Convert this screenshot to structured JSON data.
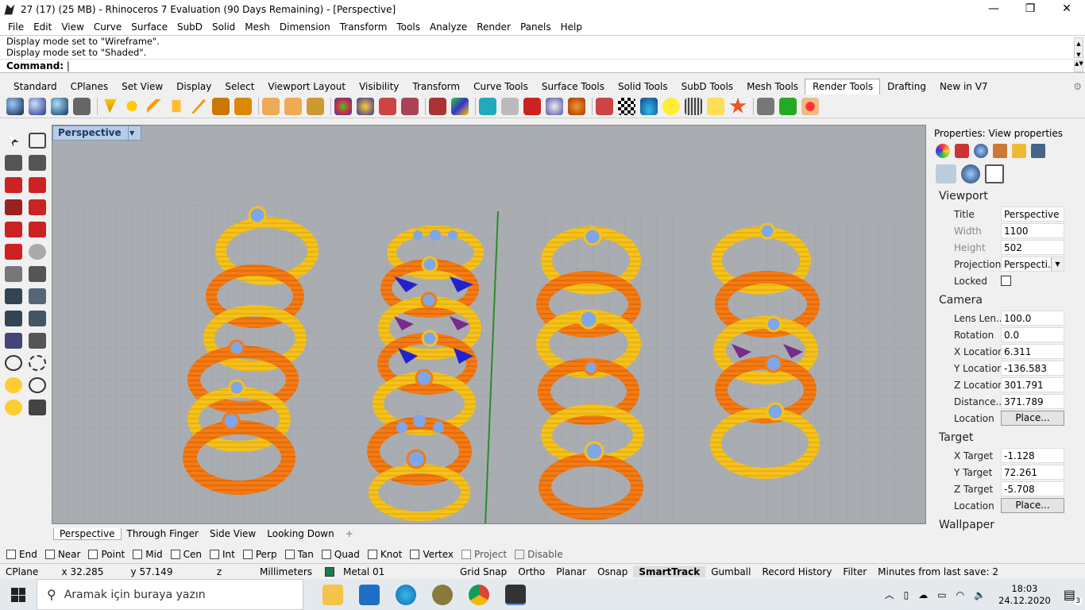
{
  "window": {
    "title": "27 (17) (25 MB) - Rhinoceros 7 Evaluation (90 Days Remaining) - [Perspective]",
    "minimize": "—",
    "restore": "❐",
    "close": "✕"
  },
  "menu": [
    "File",
    "Edit",
    "View",
    "Curve",
    "Surface",
    "SubD",
    "Solid",
    "Mesh",
    "Dimension",
    "Transform",
    "Tools",
    "Analyze",
    "Render",
    "Panels",
    "Help"
  ],
  "command_history": [
    "Display mode set to \"Wireframe\".",
    "Display mode set to \"Shaded\"."
  ],
  "command_prompt": "Command:",
  "toolbar_tabs": [
    "Standard",
    "CPlanes",
    "Set View",
    "Display",
    "Select",
    "Viewport Layout",
    "Visibility",
    "Transform",
    "Curve Tools",
    "Surface Tools",
    "Solid Tools",
    "SubD Tools",
    "Mesh Tools",
    "Render Tools",
    "Drafting",
    "New in V7"
  ],
  "active_toolbar_tab": "Render Tools",
  "viewport": {
    "name": "Perspective",
    "tabs": [
      "Perspective",
      "Through Finger",
      "Side View",
      "Looking Down"
    ],
    "add_tab": "+"
  },
  "properties": {
    "header": "Properties: View properties",
    "viewport_section": "Viewport",
    "viewport_rows": [
      {
        "key": "Title",
        "value": "Perspective",
        "dim": false
      },
      {
        "key": "Width",
        "value": "1100",
        "dim": true
      },
      {
        "key": "Height",
        "value": "502",
        "dim": true
      },
      {
        "key": "Projection",
        "value": "Perspecti...",
        "dim": false
      },
      {
        "key": "Locked",
        "value": "",
        "dim": false
      }
    ],
    "camera_section": "Camera",
    "camera_rows": [
      {
        "key": "Lens Len...",
        "value": "100.0"
      },
      {
        "key": "Rotation",
        "value": "0.0"
      },
      {
        "key": "X Location",
        "value": "6.311"
      },
      {
        "key": "Y Location",
        "value": "-136.583"
      },
      {
        "key": "Z Location",
        "value": "301.791"
      },
      {
        "key": "Distance...",
        "value": "371.789"
      },
      {
        "key": "Location",
        "value": "Place..."
      }
    ],
    "target_section": "Target",
    "target_rows": [
      {
        "key": "X Target",
        "value": "-1.128"
      },
      {
        "key": "Y Target",
        "value": "72.261"
      },
      {
        "key": "Z Target",
        "value": "-5.708"
      },
      {
        "key": "Location",
        "value": "Place..."
      }
    ],
    "wallpaper_section": "Wallpaper"
  },
  "osnap": [
    "End",
    "Near",
    "Point",
    "Mid",
    "Cen",
    "Int",
    "Perp",
    "Tan",
    "Quad",
    "Knot",
    "Vertex",
    "Project",
    "Disable"
  ],
  "status": {
    "cplane": "CPlane",
    "x": "x 32.285",
    "y": "y 57.149",
    "z": "z",
    "units": "Millimeters",
    "layer": "Metal 01",
    "layer_color": "#1e7a4e",
    "toggles": [
      "Grid Snap",
      "Ortho",
      "Planar",
      "Osnap",
      "SmartTrack",
      "Gumball",
      "Record History",
      "Filter"
    ],
    "bold_toggle": "SmartTrack",
    "save_info": "Minutes from last save: 2"
  },
  "taskbar": {
    "search_placeholder": "Aramak için buraya yazın",
    "time": "18:03",
    "date": "24.12.2020",
    "notifications": "3"
  },
  "colors": {
    "viewport_bg": "#a9adb1",
    "ring_gold": "#f5c21b",
    "ring_orange": "#f47a12",
    "gem_blue": "#7fa6e8",
    "accent_blue": "#b9cce6"
  }
}
